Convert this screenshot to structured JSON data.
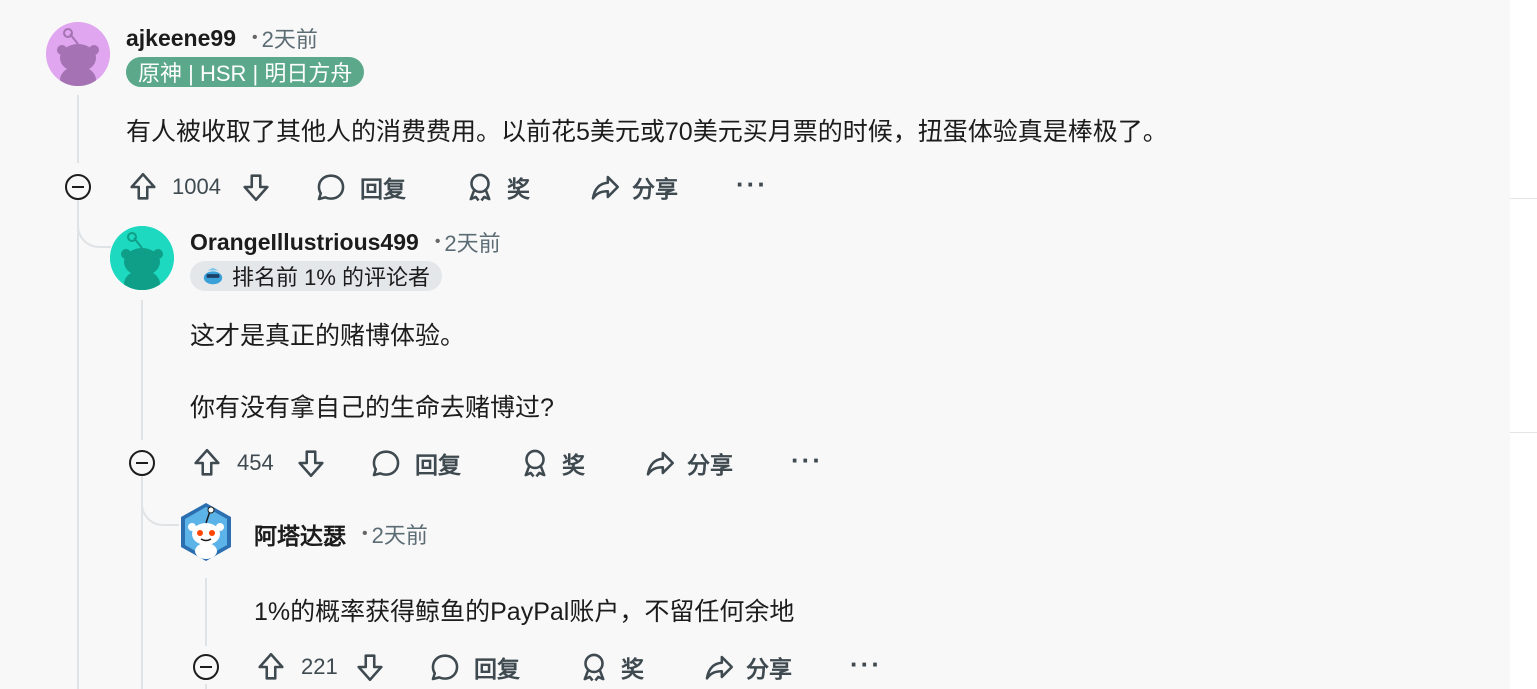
{
  "comments": [
    {
      "author": "ajkeene99",
      "time": "2天前",
      "flair": "原神 | HSR | 明日方舟",
      "body": [
        "有人被收取了其他人的消费费用。以前花5美元或70美元买月票的时候，扭蛋体验真是棒极了。"
      ],
      "votes": "1004",
      "reply": "回复",
      "award": "奖",
      "share": "分享",
      "more": "···",
      "avatar_color": "#e0a6f0"
    },
    {
      "author": "OrangeIllustrious499",
      "time": "2天前",
      "flair": "排名前 1% 的评论者",
      "body": [
        "这才是真正的赌博体验。",
        "你有没有拿自己的生命去赌博过?"
      ],
      "votes": "454",
      "reply": "回复",
      "award": "奖",
      "share": "分享",
      "more": "···",
      "avatar_color": "#1cd9c0"
    },
    {
      "author": "阿塔达瑟",
      "time": "2天前",
      "body": [
        "1%的概率获得鲸鱼的PayPal账户，不留任何余地"
      ],
      "votes": "221",
      "reply": "回复",
      "award": "奖",
      "share": "分享",
      "more": "···",
      "avatar_color": "#2b6fb0"
    }
  ],
  "meta_separator": "•",
  "colors": {
    "flair_green": "#5ba88a",
    "flair_gray": "#e4e7ea",
    "action_text": "#3e4a50"
  },
  "icons": [
    "upvote-icon",
    "downvote-icon",
    "comment-icon",
    "award-icon",
    "share-icon",
    "collapse-icon",
    "trophy-badge-icon"
  ]
}
